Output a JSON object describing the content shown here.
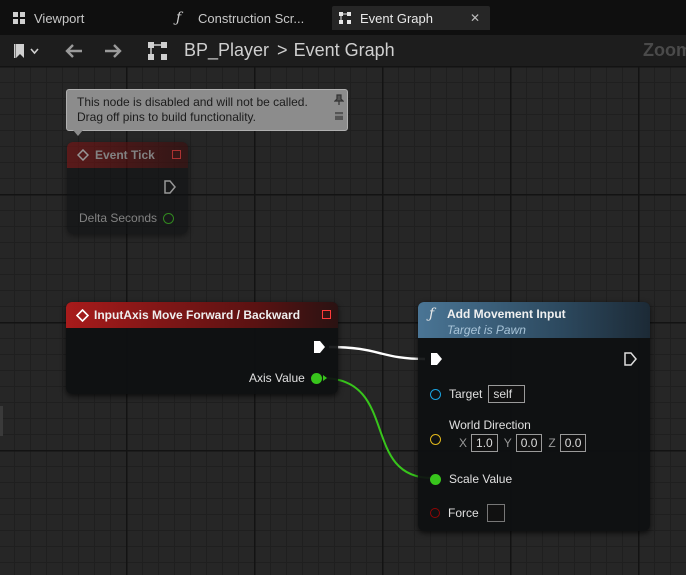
{
  "tabs": [
    {
      "label": "Viewport",
      "icon": "viewport-grid-icon"
    },
    {
      "label": "Construction Scr...",
      "icon": "function-icon"
    },
    {
      "label": "Event Graph",
      "icon": "graph-icon",
      "active": true,
      "close": "✕"
    }
  ],
  "toolbar": {
    "breadcrumb_blueprint": "BP_Player",
    "breadcrumb_separator": ">",
    "breadcrumb_graph": "Event Graph",
    "zoom_label": "Zoom"
  },
  "tooltip": {
    "line1": "This node is disabled and will not be called.",
    "line2": "Drag off pins to build functionality."
  },
  "event_tick_node": {
    "title": "Event Tick",
    "pin_delta": "Delta Seconds"
  },
  "input_axis_node": {
    "title": "InputAxis Move Forward / Backward",
    "pin_axis_value": "Axis Value"
  },
  "add_movement_node": {
    "title": "Add Movement Input",
    "subtitle": "Target is Pawn",
    "pin_target": "Target",
    "target_value": "self",
    "pin_world_direction": "World Direction",
    "x_label": "X",
    "x_value": "1.0",
    "y_label": "Y",
    "y_value": "0.0",
    "z_label": "Z",
    "z_value": "0.0",
    "pin_scale_value": "Scale Value",
    "pin_force": "Force"
  },
  "colors": {
    "event_head": "#8a1515",
    "function_head": "#3d6483",
    "float_pin": "#38c51c",
    "object_pin": "#1aa3e0",
    "vector_pin": "#e0b71c",
    "bool_pin": "#8e0606",
    "exec_pin": "#ffffff"
  }
}
